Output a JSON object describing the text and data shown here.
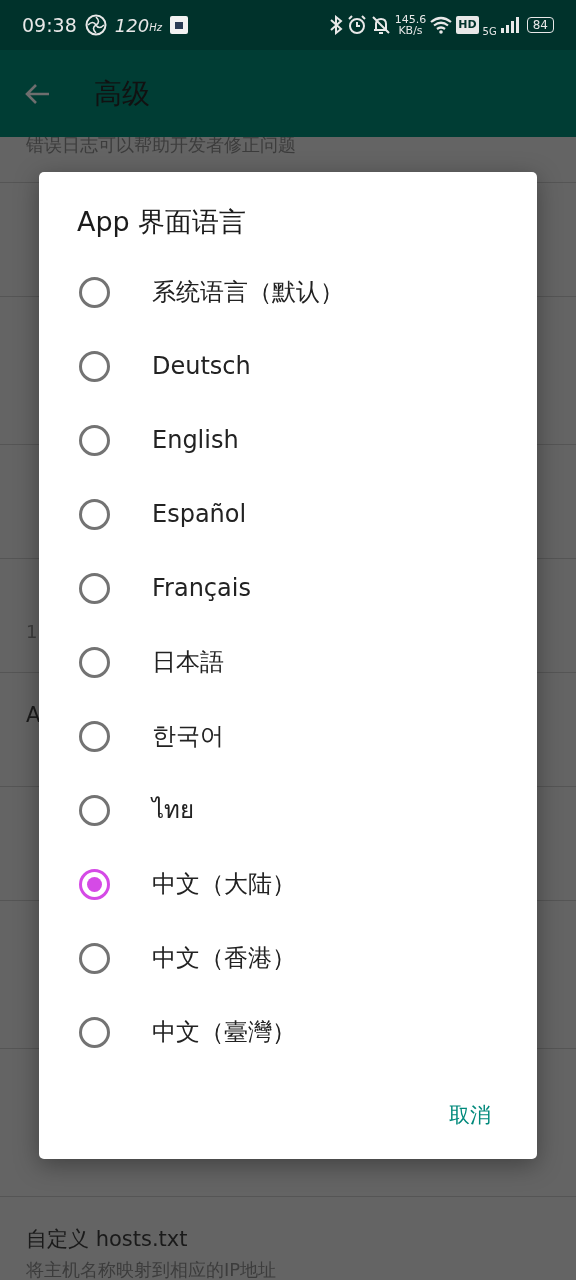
{
  "status_bar": {
    "time": "09:38",
    "refresh_rate": "120",
    "refresh_unit": "Hz",
    "net_speed": "145.6",
    "net_unit": "KB/s",
    "hd": "HD",
    "network": "5G",
    "battery": "84"
  },
  "app_bar": {
    "title": "高级"
  },
  "settings": [
    {
      "lines": [
        "错误日志可以帮助开发者修正问题"
      ]
    },
    {
      "lines": [
        "1"
      ]
    },
    {
      "title": "A"
    },
    {
      "title": "自定义 hosts.txt",
      "lines": [
        "将主机名称映射到相应的IP地址"
      ]
    }
  ],
  "dialog": {
    "title": "App 界面语言",
    "options": [
      {
        "label": "系统语言（默认）",
        "selected": false
      },
      {
        "label": "Deutsch",
        "selected": false
      },
      {
        "label": "English",
        "selected": false
      },
      {
        "label": "Español",
        "selected": false
      },
      {
        "label": "Français",
        "selected": false
      },
      {
        "label": "日本語",
        "selected": false
      },
      {
        "label": "한국어",
        "selected": false
      },
      {
        "label": "ไทย",
        "selected": false
      },
      {
        "label": "中文（大陆）",
        "selected": true
      },
      {
        "label": "中文（香港）",
        "selected": false
      },
      {
        "label": "中文（臺灣）",
        "selected": false
      }
    ],
    "button": "取消"
  }
}
